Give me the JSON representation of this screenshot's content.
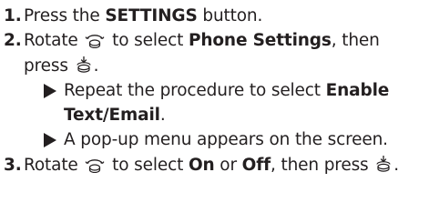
{
  "steps": [
    {
      "number": "1.",
      "text_before": "Press the ",
      "bold": "SETTINGS",
      "text_after": " button."
    },
    {
      "number": "2.",
      "rotate_prefix": "Rotate",
      "select_text": " to select ",
      "bold_target": "Phone Settings",
      "then_press": ", then press",
      "end_period": ".",
      "substeps": [
        {
          "text": "Repeat the procedure to select ",
          "bold": "Enable Text/Email",
          "end": "."
        },
        {
          "text": "A pop-up menu appears on the screen."
        }
      ]
    },
    {
      "number": "3.",
      "rotate_prefix": "Rotate",
      "select_text": " to select ",
      "bold_on": "On",
      "or_text": " or ",
      "bold_off": "Off",
      "then_press": ", then press",
      "end_period": "."
    }
  ],
  "icons": {
    "rotate": "rotary-knob-icon",
    "press": "press-knob-icon",
    "substep_marker": "right-triangle-icon"
  }
}
